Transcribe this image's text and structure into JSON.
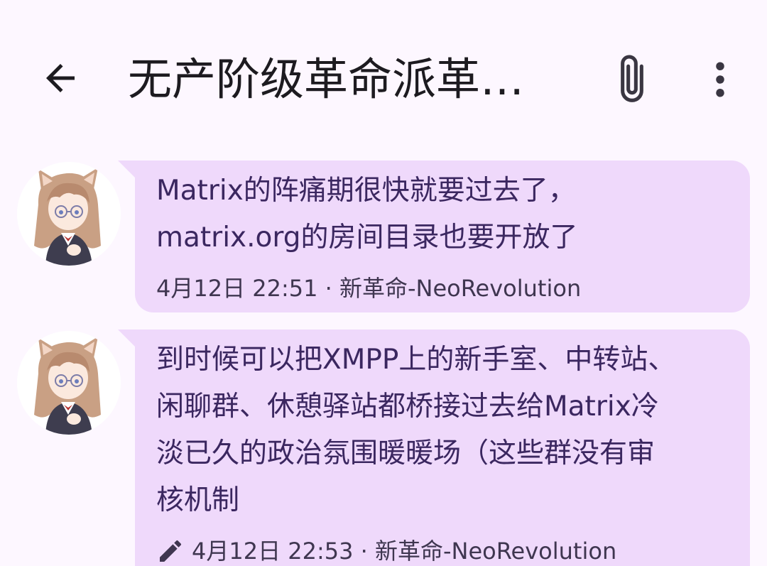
{
  "header": {
    "title": "无产阶级革命派革…",
    "back_icon": "arrow-back-icon",
    "attach_icon": "paperclip-icon",
    "more_icon": "more-vert-icon"
  },
  "messages": [
    {
      "avatar_icon": "user-avatar-anime-catgirl",
      "lines": [
        "Matrix的阵痛期很快就要过去了，",
        "matrix.org的房间目录也要开放了"
      ],
      "date": "4月12日",
      "time": "22:51",
      "separator": "·",
      "sender": "新革命-NeoRevolution",
      "edited": false
    },
    {
      "avatar_icon": "user-avatar-anime-catgirl",
      "lines": [
        "到时候可以把XMPP上的新手室、中转站、",
        "闲聊群、休憩驿站都桥接过去给Matrix冷",
        "淡已久的政治氛围暖暖场（这些群没有审",
        "核机制"
      ],
      "date": "4月12日",
      "time": "22:53",
      "separator": "·",
      "sender": "新革命-NeoRevolution",
      "edited": true,
      "edit_icon": "pencil-edit-icon"
    }
  ],
  "colors": {
    "background": "#fdf7ff",
    "bubble": "#efd9fb",
    "message_text": "#3b2760",
    "meta_text": "#3f3650"
  }
}
